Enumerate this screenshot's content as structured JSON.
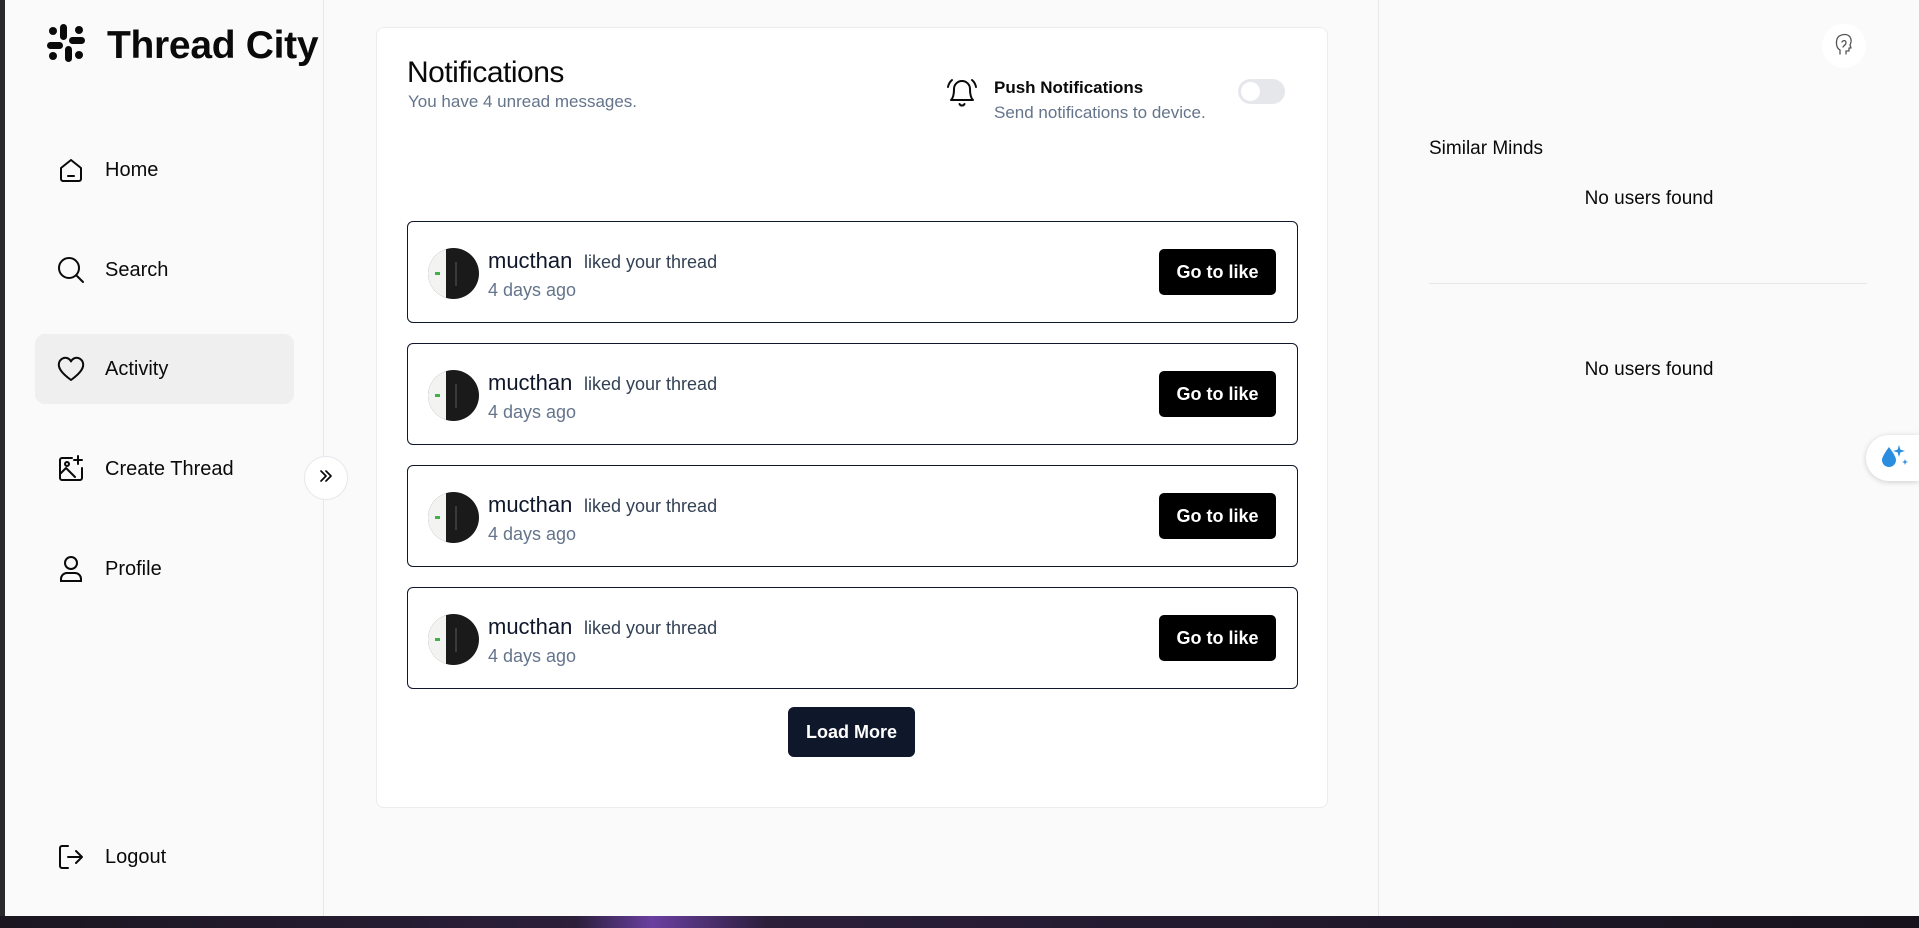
{
  "app": {
    "title": "Thread City"
  },
  "sidebar": {
    "items": [
      {
        "label": "Home",
        "icon": "home-icon"
      },
      {
        "label": "Search",
        "icon": "search-icon"
      },
      {
        "label": "Activity",
        "icon": "heart-icon",
        "active": true,
        "badge_icon": "bell-icon"
      },
      {
        "label": "Create Thread",
        "icon": "image-plus-icon"
      },
      {
        "label": "Profile",
        "icon": "user-icon"
      }
    ],
    "logout_label": "Logout",
    "collapse_icon": "chevrons-right-icon"
  },
  "notifications": {
    "title": "Notifications",
    "subtitle": "You have 4 unread messages.",
    "push": {
      "title": "Push Notifications",
      "subtitle": "Send notifications to device.",
      "enabled": false
    },
    "items": [
      {
        "user": "mucthan",
        "action": "liked your thread",
        "time": "4 days ago",
        "button": "Go to like"
      },
      {
        "user": "mucthan",
        "action": "liked your thread",
        "time": "4 days ago",
        "button": "Go to like"
      },
      {
        "user": "mucthan",
        "action": "liked your thread",
        "time": "4 days ago",
        "button": "Go to like"
      },
      {
        "user": "mucthan",
        "action": "liked your thread",
        "time": "4 days ago",
        "button": "Go to like"
      }
    ],
    "load_more": "Load More"
  },
  "right_panel": {
    "section_title": "Similar Minds",
    "empty_1": "No users found",
    "empty_2": "No users found"
  },
  "colors": {
    "primary_button": "#000000",
    "load_more": "#0f172a",
    "muted_text": "#64748b",
    "alert": "#ef4444",
    "ai_blue": "#2b8de0"
  }
}
